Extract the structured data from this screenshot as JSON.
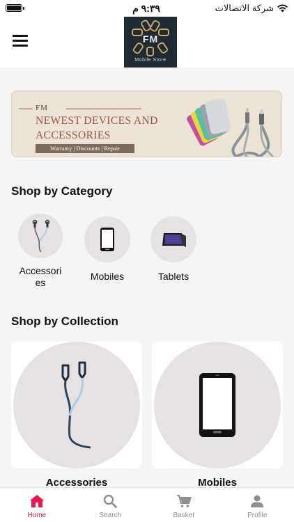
{
  "status_bar": {
    "time": "٩:٣٩ م",
    "carrier": "شركة الاتصالات"
  },
  "header": {
    "logo_text": "FM",
    "logo_subtitle": "Mobile Store"
  },
  "banner": {
    "brand": "FM",
    "title_line1": "NEWEST DEVICES AND",
    "title_line2": "ACCESSORIES",
    "tagline": "Warranty | Discounts | Repair"
  },
  "categories": {
    "title": "Shop by Category",
    "items": [
      {
        "label": "Accessori es",
        "icon": "earphones-icon"
      },
      {
        "label": "Mobiles",
        "icon": "mobile-phone-icon"
      },
      {
        "label": "Tablets",
        "icon": "tablet-icon"
      }
    ]
  },
  "collections": {
    "title": "Shop by Collection",
    "items": [
      {
        "label": "Accessories",
        "icon": "earphones-icon"
      },
      {
        "label": "Mobiles",
        "icon": "mobile-phone-icon"
      }
    ]
  },
  "tabbar": {
    "items": [
      {
        "label": "Home",
        "icon": "home-icon",
        "active": true
      },
      {
        "label": "Search",
        "icon": "search-icon",
        "active": false
      },
      {
        "label": "Basket",
        "icon": "cart-icon",
        "active": false
      },
      {
        "label": "Profile",
        "icon": "profile-icon",
        "active": false
      }
    ]
  },
  "colors": {
    "accent": "#e8194a",
    "inactive": "#8e8e93",
    "circle_bg": "#e6e2e1"
  }
}
